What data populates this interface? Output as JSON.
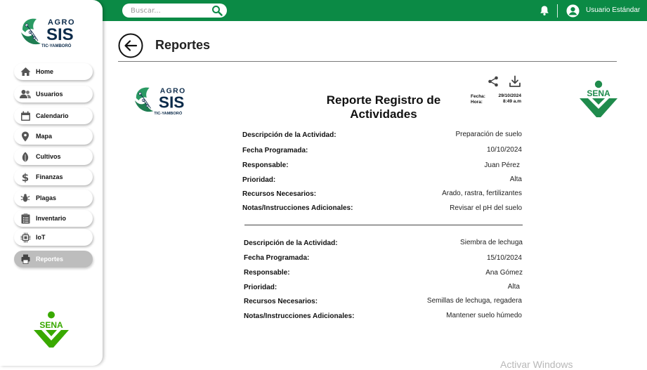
{
  "search": {
    "placeholder": "Buscar..."
  },
  "user": {
    "name": "Usuario Estándar"
  },
  "brand": {
    "agro": "AGRO",
    "sis": "SIS",
    "tagline": "TIC-YAMBORÓ",
    "sena": "SENA"
  },
  "sidebar": {
    "items": [
      {
        "label": "Home",
        "icon": "home-icon"
      },
      {
        "label": "Usuarios",
        "icon": "users-icon"
      },
      {
        "label": "Calendario",
        "icon": "calendar-icon"
      },
      {
        "label": "Mapa",
        "icon": "map-pin-icon"
      },
      {
        "label": "Cultivos",
        "icon": "leaf-icon"
      },
      {
        "label": "Finanzas",
        "icon": "dollar-icon"
      },
      {
        "label": "Plagas",
        "icon": "bug-icon"
      },
      {
        "label": "Inventario",
        "icon": "clipboard-icon"
      },
      {
        "label": "IoT",
        "icon": "chip-icon"
      },
      {
        "label": "Reportes",
        "icon": "printer-icon",
        "active": true
      }
    ]
  },
  "page": {
    "title": "Reportes"
  },
  "report": {
    "title": "Reporte Registro de Actividades",
    "fecha_label": "Fecha:",
    "fecha_value": "29/10/2024",
    "hora_label": "Hora:",
    "hora_value": "8:49 a.m",
    "records": [
      {
        "rows": [
          {
            "label": "Descripción de la Actividad:",
            "value": "Preparación de suelo"
          },
          {
            "label": "Fecha Programada:",
            "value": "10/10/2024"
          },
          {
            "label": "Responsable:",
            "value": "Juan Pérez"
          },
          {
            "label": "Prioridad:",
            "value": "Alta"
          },
          {
            "label": "Recursos Necesarios:",
            "value": "Arado, rastra, fertilizantes"
          },
          {
            "label": "Notas/Instrucciones Adicionales:",
            "value": "Revisar el pH del suelo"
          }
        ]
      },
      {
        "rows": [
          {
            "label": "Descripción de la Actividad:",
            "value": "Siembra de lechuga"
          },
          {
            "label": "Fecha Programada:",
            "value": "15/10/2024"
          },
          {
            "label": "Responsable:",
            "value": "Ana Gómez"
          },
          {
            "label": "Prioridad:",
            "value": "Alta"
          },
          {
            "label": "Recursos Necesarios:",
            "value": "Semillas de lechuga, regadera"
          },
          {
            "label": "Notas/Instrucciones Adicionales:",
            "value": "Mantener suelo húmedo"
          }
        ]
      }
    ]
  },
  "watermark": "Activar Windows",
  "colors": {
    "primary_green": "#0b8a45",
    "sena_green": "#39a900",
    "navy": "#0c2b4a",
    "active_item": "#bdbdbd"
  }
}
